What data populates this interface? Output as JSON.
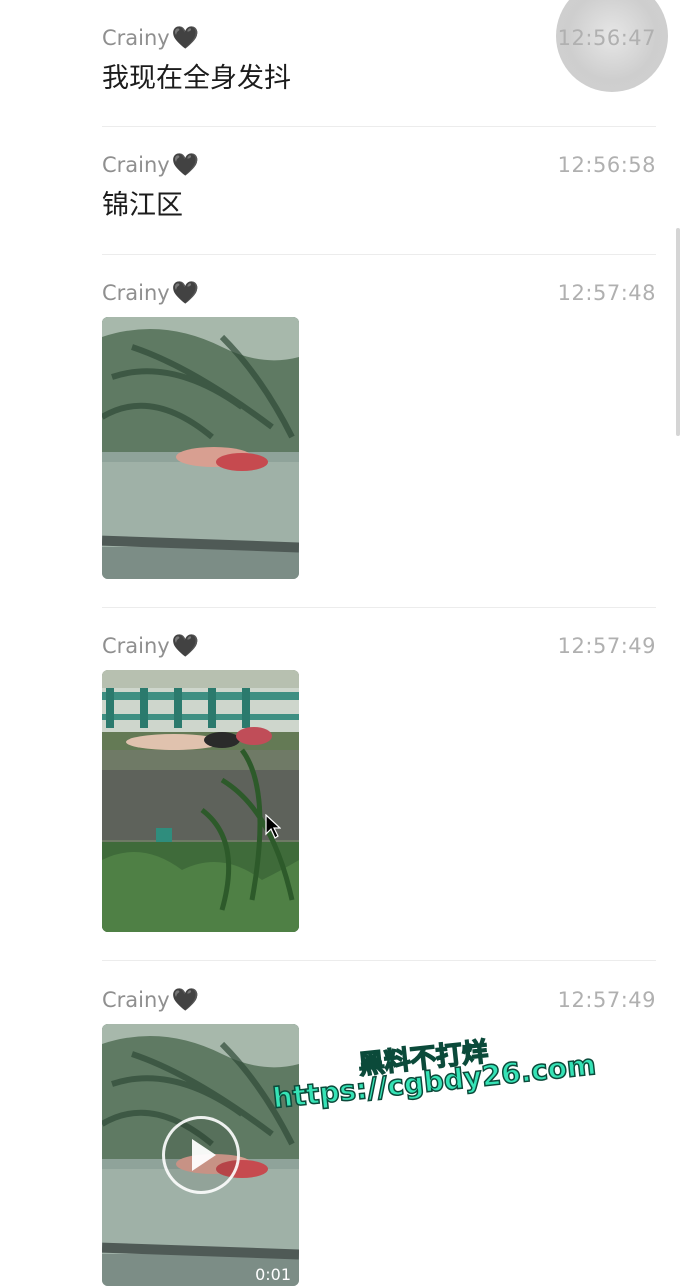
{
  "messages": [
    {
      "sender": "Crainy",
      "heart": "🖤",
      "time": "12:56:47",
      "text": "我现在全身发抖"
    },
    {
      "sender": "Crainy",
      "heart": "🖤",
      "time": "12:56:58",
      "text": "锦江区"
    },
    {
      "sender": "Crainy",
      "heart": "🖤",
      "time": "12:57:48",
      "media": "photo"
    },
    {
      "sender": "Crainy",
      "heart": "🖤",
      "time": "12:57:49",
      "media": "photo"
    },
    {
      "sender": "Crainy",
      "heart": "🖤",
      "time": "12:57:49",
      "media": "video",
      "duration": "0:01"
    }
  ],
  "watermark": {
    "line1": "黑料不打烊",
    "line2": "https://cgbdy26.com",
    "color": "#36e3b6"
  },
  "icons": {
    "play": "play-icon",
    "heart": "black-heart-icon",
    "cursor": "mouse-pointer-icon"
  }
}
